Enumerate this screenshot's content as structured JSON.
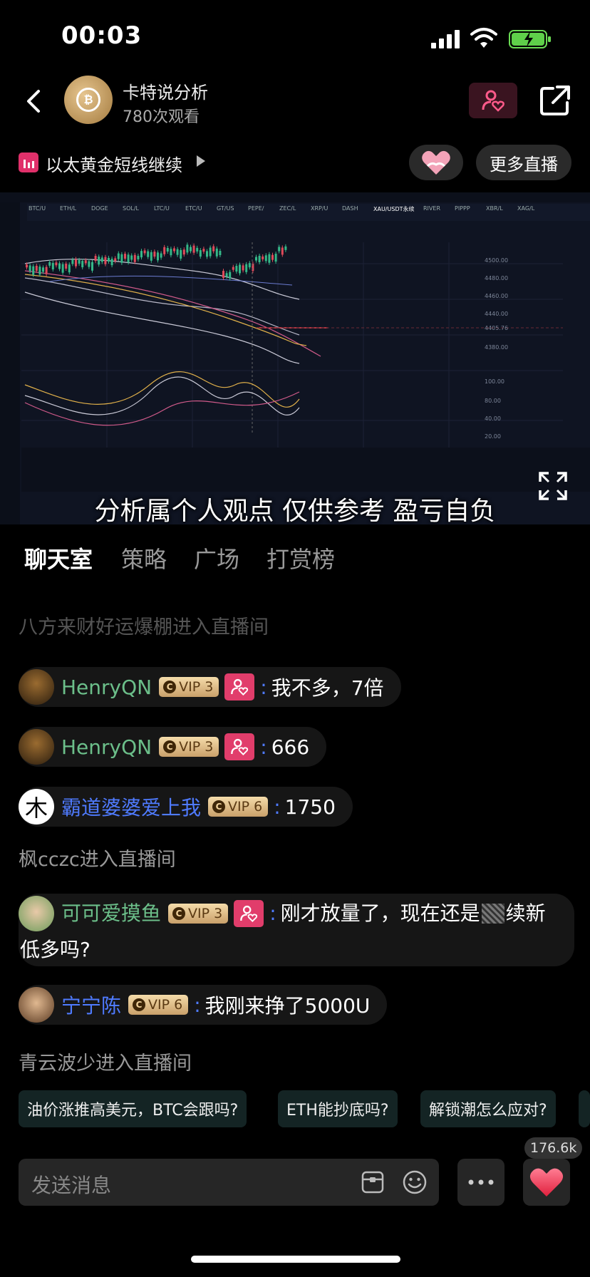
{
  "status_bar": {
    "time": "00:03"
  },
  "header": {
    "host_name": "卡特说分析",
    "views": "780次观看",
    "avatar_text": "卡特说分析"
  },
  "live": {
    "title": "以太黄金短线继续",
    "more_live_label": "更多直播"
  },
  "video": {
    "subtitle": "分析属个人观点 仅供参考 盈亏自负",
    "ticker_tabs": [
      "BTC/U",
      "ETH/L",
      "DOGE",
      "SOL/L",
      "LTC/U",
      "ETC/U",
      "GT/US",
      "PEPE/",
      "ZEC/L",
      "XRP/U",
      "DASH",
      "XAU/USDT永续",
      "RIVER",
      "PIPPP",
      "XBR/L",
      "XAG/L"
    ]
  },
  "tabs": [
    "聊天室",
    "策略",
    "广场",
    "打赏榜"
  ],
  "chat": {
    "faded_system": "八方来财好运爆棚进入直播间",
    "messages": [
      {
        "user": "HenryQN",
        "vip": "VIP 3",
        "fan": true,
        "text": "我不多，7倍",
        "color": "green"
      },
      {
        "user": "HenryQN",
        "vip": "VIP 3",
        "fan": true,
        "text": "666",
        "color": "green"
      },
      {
        "user": "霸道婆婆爱上我",
        "vip": "VIP 6",
        "fan": false,
        "text": "1750",
        "color": "blue",
        "avatar_char": "木"
      },
      {
        "system": "枫cczc进入直播间"
      },
      {
        "user": "可可爱摸鱼",
        "vip": "VIP 3",
        "fan": true,
        "text_line1": "刚才放量了，现在还是",
        "text_line1_end": "续新",
        "text_line2": "低多吗?",
        "color": "green"
      },
      {
        "user": "宁宁陈",
        "vip": "VIP 6",
        "fan": false,
        "text": "我刚来挣了5000U",
        "color": "blue"
      },
      {
        "system": "青云波少进入直播间"
      }
    ]
  },
  "suggestions": [
    "油价涨推高美元，BTC会跟吗?",
    "ETH能抄底吗?",
    "解锁潮怎么应对?"
  ],
  "bottom": {
    "placeholder": "发送消息",
    "like_count": "176.6k"
  }
}
